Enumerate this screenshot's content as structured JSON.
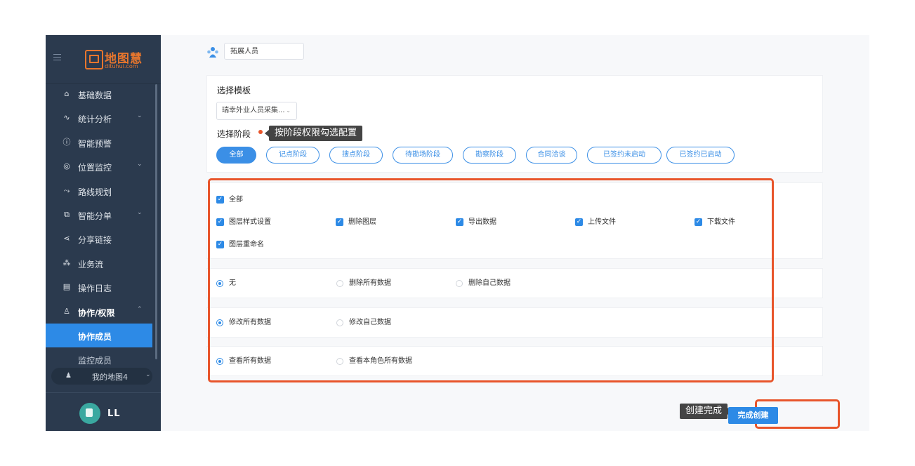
{
  "brand": {
    "name": "地图慧",
    "domain": "dituhui.com",
    "color": "#e8762d"
  },
  "sidebar": {
    "items": [
      {
        "label": "基础数据",
        "icon": "home-icon",
        "glyph": "⌂",
        "chevron": ""
      },
      {
        "label": "统计分析",
        "icon": "chart-icon",
        "glyph": "∿",
        "chevron": "⌄"
      },
      {
        "label": "智能预警",
        "icon": "info-icon",
        "glyph": "ⓘ",
        "chevron": ""
      },
      {
        "label": "位置监控",
        "icon": "location-icon",
        "glyph": "◎",
        "chevron": "⌄"
      },
      {
        "label": "路线规划",
        "icon": "route-icon",
        "glyph": "⤳",
        "chevron": ""
      },
      {
        "label": "智能分单",
        "icon": "dispatch-icon",
        "glyph": "⧉",
        "chevron": "⌄"
      },
      {
        "label": "分享链接",
        "icon": "share-icon",
        "glyph": "⋖",
        "chevron": ""
      },
      {
        "label": "业务流",
        "icon": "workflow-icon",
        "glyph": "⁂",
        "chevron": ""
      },
      {
        "label": "操作日志",
        "icon": "calendar-icon",
        "glyph": "▤",
        "chevron": ""
      },
      {
        "label": "协作/权限",
        "icon": "user-icon",
        "glyph": "♙",
        "chevron": "⌃"
      }
    ],
    "subitems": [
      "协作成员",
      "监控成员"
    ],
    "map_selector": "我的地图4",
    "map_chevron": "⌄",
    "user_name": "LL"
  },
  "role": {
    "value": "拓展人员",
    "icon": "team-icon"
  },
  "template": {
    "title": "选择模板",
    "value": "瑞幸外业人员采集...",
    "chevron": "⌄"
  },
  "stage": {
    "title": "选择阶段",
    "tooltip": "按阶段权限勾选配置",
    "options": [
      "全部",
      "记点阶段",
      "搜点阶段",
      "待勘场阶段",
      "勘察阶段",
      "合同洽谈",
      "已签约未启动",
      "已签约已启动"
    ],
    "selected": "全部"
  },
  "permissions": {
    "all_label": "全部",
    "checkboxes": [
      "图层样式设置",
      "删除图层",
      "导出数据",
      "上传文件",
      "下载文件",
      "图层重命名"
    ],
    "check_glyph": "✓",
    "delete_group": {
      "options": [
        "无",
        "删除所有数据",
        "删除自己数据"
      ],
      "selected": "无"
    },
    "edit_group": {
      "options": [
        "修改所有数据",
        "修改自己数据"
      ],
      "selected": "修改所有数据"
    },
    "view_group": {
      "options": [
        "查看所有数据",
        "查看本角色所有数据"
      ],
      "selected": "查看所有数据"
    }
  },
  "footer": {
    "tooltip": "创建完成",
    "submit_label": "完成创建"
  },
  "colors": {
    "accent": "#2d8ae6",
    "highlight": "#e8552b",
    "sidebar": "#2b3a4e"
  }
}
